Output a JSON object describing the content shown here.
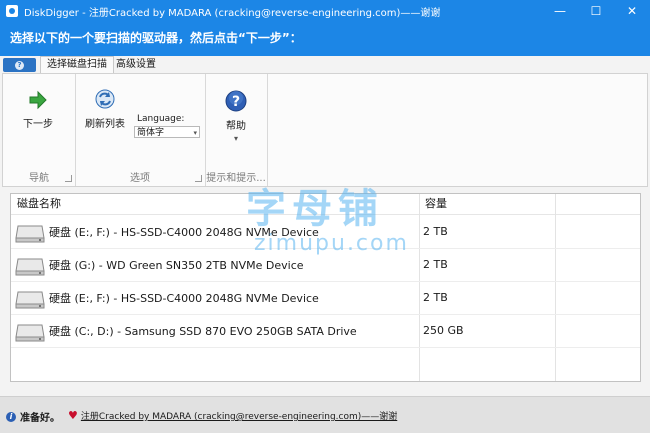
{
  "window": {
    "title": "DiskDigger - 注册Cracked by MADARA (cracking@reverse-engineering.com)——谢谢",
    "minimize_symbol": "—",
    "maximize_symbol": "☐",
    "close_symbol": "✕"
  },
  "instruction": "选择以下的一个要扫描的驱动器，然后点击“下一步”：",
  "ribbon": {
    "app_menu_symbol": "?",
    "tabs": [
      {
        "label": "选择磁盘扫描",
        "active": true
      },
      {
        "label": "高级设置",
        "active": false
      }
    ],
    "groups": {
      "nav": {
        "label": "导航",
        "next_label": "下一步",
        "next_icon": "green-arrow-right-icon"
      },
      "options": {
        "label": "选项",
        "refresh_label": "刷新列表",
        "refresh_icon": "refresh-icon",
        "language_label": "Language:",
        "language_value": "简体字"
      },
      "hints": {
        "label": "提示和提示...",
        "help_label": "帮助",
        "help_icon": "help-icon",
        "dropdown_symbol": "▾"
      }
    }
  },
  "drive_list": {
    "columns": [
      "磁盘名称",
      "容量"
    ],
    "rows": [
      {
        "name": "硬盘 (E:, F:) - HS-SSD-C4000 2048G NVMe Device",
        "capacity": "2 TB"
      },
      {
        "name": "硬盘 (G:) - WD Green SN350 2TB NVMe Device",
        "capacity": "2 TB"
      },
      {
        "name": "硬盘 (E:, F:) - HS-SSD-C4000 2048G NVMe Device",
        "capacity": "2 TB"
      },
      {
        "name": "硬盘 (C:, D:) - Samsung SSD 870 EVO 250GB SATA Drive",
        "capacity": "250 GB"
      }
    ]
  },
  "status": {
    "ready": "准备好。",
    "info_symbol": "i",
    "heart_symbol": "♥",
    "link": "注册Cracked by MADARA (cracking@reverse-engineering.com)——谢谢"
  },
  "watermark": {
    "line1": "字母铺",
    "line2": "zimupu.com"
  },
  "colors": {
    "titlebar": "#1c86e6",
    "accent": "#2b73c4",
    "heart": "#c8102e"
  }
}
